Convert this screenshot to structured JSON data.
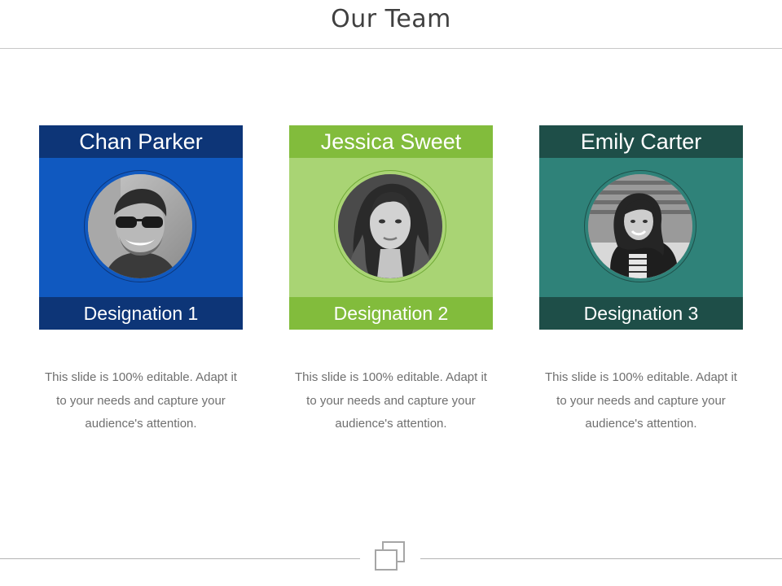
{
  "header": {
    "title": "Our Team"
  },
  "team": [
    {
      "name": "Chan Parker",
      "designation": "Designation 1",
      "description": "This slide is 100% editable. Adapt it to your needs and capture your audience's attention.",
      "colors": {
        "header": "#0d3577",
        "body": "#1059c0",
        "ring": "#0d3577"
      }
    },
    {
      "name": "Jessica Sweet",
      "designation": "Designation 2",
      "description": "This slide is 100% editable. Adapt it to your needs and capture your audience's attention.",
      "colors": {
        "header": "#82bc3c",
        "body": "#a9d474",
        "ring": "#6ea834"
      }
    },
    {
      "name": "Emily Carter",
      "designation": "Designation 3",
      "description": "This slide is 100% editable. Adapt it to your needs and capture your audience's attention.",
      "colors": {
        "header": "#1e4e48",
        "body": "#2f8279",
        "ring": "#1e4e48"
      }
    }
  ],
  "footer": {
    "icon": "copy-icon"
  }
}
